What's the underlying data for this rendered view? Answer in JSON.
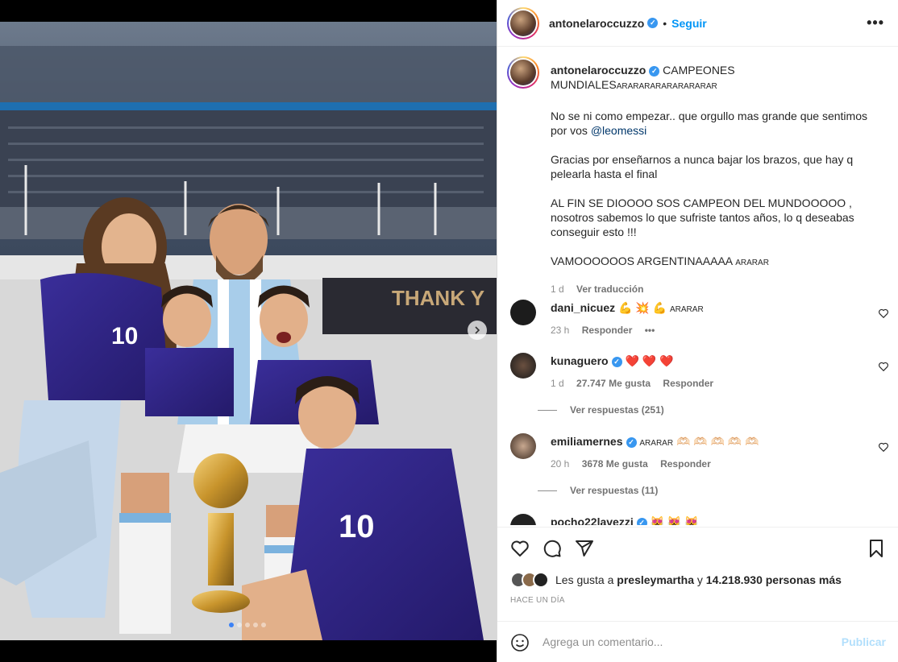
{
  "post": {
    "username": "antonelaroccuzzo",
    "follow_label": "Seguir",
    "more_icon": "more-horizontal-icon",
    "dot": "•"
  },
  "caption": {
    "username": "antonelaroccuzzo",
    "title": "CAMPEONES MUNDIALES",
    "title_small": "ARARARARARARARARAR",
    "line1": "No se ni como empezar.. que orgullo mas grande que sentimos por vos",
    "mention": "@leomessi",
    "line2": "Gracias por enseñarnos a nunca bajar los brazos, que hay q pelearla hasta el final",
    "line3": "AL FIN SE DIOOOO SOS CAMPEON DEL MUNDOOOOO , nosotros sabemos lo que sufriste tantos años, lo q deseabas conseguir esto !!!",
    "line4": "VAMOOOOOOS ARGENTINAAAAA",
    "line4_small": "ARARAR",
    "time": "1 d",
    "translate": "Ver traducción"
  },
  "comments": [
    {
      "username": "dani_nicuez",
      "text": "💪 💥 💪",
      "small": "ARARAR",
      "time": "23 h",
      "likes": "",
      "reply": "Responder",
      "options": "•••",
      "replies": ""
    },
    {
      "username": "kunaguero",
      "text": "❤️ ❤️ ❤️",
      "small": "",
      "time": "1 d",
      "likes": "27.747 Me gusta",
      "reply": "Responder",
      "options": "",
      "replies": "Ver respuestas (251)"
    },
    {
      "username": "emiliamernes",
      "text": "🫶🏻 🫶🏻 🫶🏻 🫶🏻 🫶🏻",
      "small": "ARARAR",
      "time": "20 h",
      "likes": "3678 Me gusta",
      "reply": "Responder",
      "options": "",
      "replies": "Ver respuestas (11)"
    },
    {
      "username": "pocho22lavezzi",
      "text": "😻 😻 😻",
      "small": "",
      "time": "",
      "likes": "",
      "reply": "",
      "options": "",
      "replies": ""
    }
  ],
  "likes": {
    "prefix": "Les gusta a",
    "user": "presleymartha",
    "and": "y",
    "count": "14.218.930 personas más"
  },
  "when": "HACE UN DÍA",
  "comment_box": {
    "placeholder": "Agrega un comentario...",
    "publish": "Publicar"
  },
  "photo": {
    "banner_text": "THANK Y"
  },
  "colors": {
    "link": "#0095f6",
    "mention": "#00376b",
    "verified": "#3897f0"
  }
}
